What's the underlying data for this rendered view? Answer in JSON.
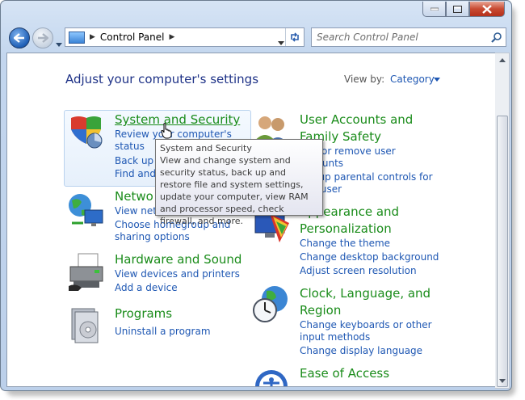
{
  "window": {
    "address": {
      "location": "Control Panel"
    },
    "search": {
      "placeholder": "Search Control Panel"
    }
  },
  "header": {
    "title": "Adjust your computer's settings",
    "view_by_label": "View by:",
    "view_by_value": "Category"
  },
  "categories": {
    "system": {
      "title": "System and Security",
      "links": [
        "Review your computer's",
        "status",
        "Back up y",
        "Find and"
      ]
    },
    "network": {
      "title": "Network and Internet",
      "title_visible": "Netwo",
      "links": [
        "View netw",
        "Choose homegroup and",
        "sharing options"
      ]
    },
    "hardware": {
      "title": "Hardware and Sound",
      "links": [
        "View devices and printers",
        "Add a device"
      ]
    },
    "programs": {
      "title": "Programs",
      "links": [
        "Uninstall a program"
      ]
    },
    "user": {
      "title_line1": "User Accounts and",
      "title_line2": "Family Safety",
      "links": [
        "Add or remove user",
        "accounts",
        "Set up parental controls for",
        "any user"
      ]
    },
    "appearance": {
      "title_line1": "Appearance and",
      "title_line2": "Personalization",
      "links": [
        "Change the theme",
        "Change desktop background",
        "Adjust screen resolution"
      ]
    },
    "clock": {
      "title_line1": "Clock, Language, and",
      "title_line2": "Region",
      "links": [
        "Change keyboards or other",
        "input methods",
        "Change display language"
      ]
    },
    "ease": {
      "title": "Ease of Access"
    }
  },
  "tooltip": {
    "title": "System and Security",
    "body": "View and change system and security status, back up and restore file and system settings, update your computer, view RAM and processor speed, check firewall, and more."
  },
  "colors": {
    "link": "#1e57b3",
    "category_title": "#1a8c1a",
    "page_title": "#1e3287"
  }
}
